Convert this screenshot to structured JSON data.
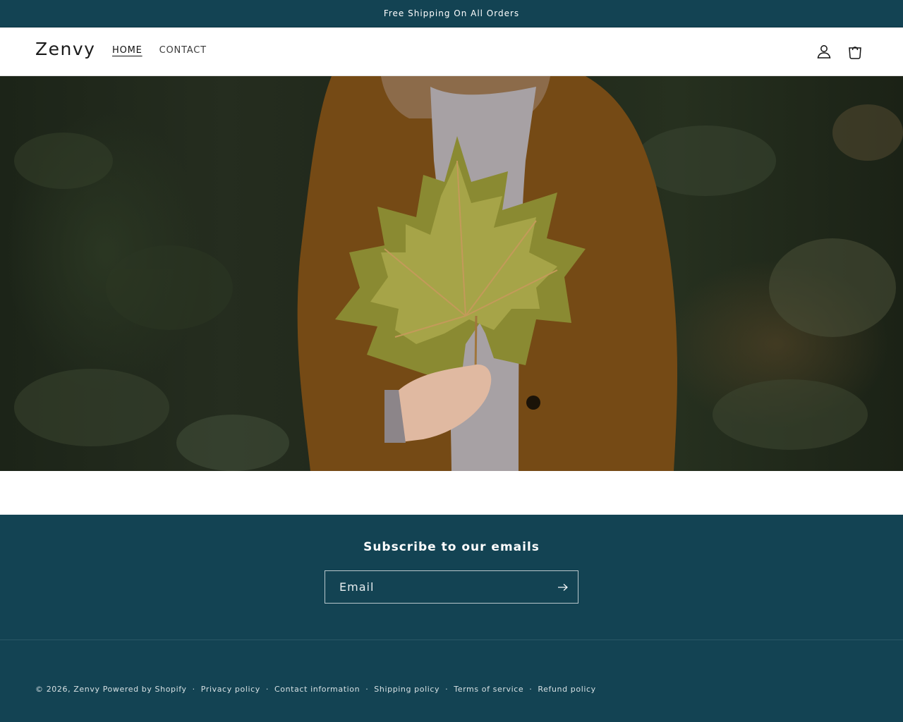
{
  "announcement": {
    "text": "Free Shipping On All Orders"
  },
  "header": {
    "logo": "Zenvy",
    "nav": [
      {
        "label": "HOME"
      },
      {
        "label": "CONTACT"
      }
    ],
    "icons": [
      "account-icon",
      "cart-icon"
    ]
  },
  "hero": {
    "image": "woman-in-brown-cardigan-holding-autumn-leaf"
  },
  "footer": {
    "newsletter_title": "Subscribe to our emails",
    "email_placeholder": "Email",
    "copyright_prefix": "© 2026,",
    "store_link": "Zenvy",
    "powered_by": "Powered by Shopify",
    "separator": "·",
    "policies": [
      {
        "label": "Privacy policy"
      },
      {
        "label": "Contact information"
      },
      {
        "label": "Shipping policy"
      },
      {
        "label": "Terms of service"
      },
      {
        "label": "Refund policy"
      }
    ]
  },
  "colors": {
    "brand_teal": "#134353",
    "header_bg": "#ffffff"
  }
}
